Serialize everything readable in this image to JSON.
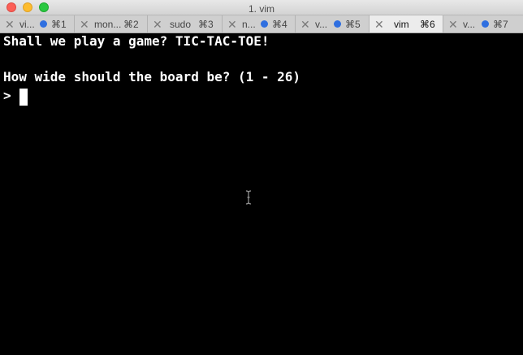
{
  "window": {
    "title": "1. vim"
  },
  "tabs": [
    {
      "label": "vi...",
      "shortcut": "⌘1",
      "has_dot": true,
      "active": false
    },
    {
      "label": "mon...",
      "shortcut": "⌘2",
      "has_dot": false,
      "active": false
    },
    {
      "label": "sudo",
      "shortcut": "⌘3",
      "has_dot": false,
      "active": false
    },
    {
      "label": "n...",
      "shortcut": "⌘4",
      "has_dot": true,
      "active": false
    },
    {
      "label": "v...",
      "shortcut": "⌘5",
      "has_dot": true,
      "active": false
    },
    {
      "label": "vim",
      "shortcut": "⌘6",
      "has_dot": false,
      "active": true
    },
    {
      "label": "v...",
      "shortcut": "⌘7",
      "has_dot": true,
      "active": false
    }
  ],
  "terminal": {
    "line1": "Shall we play a game? TIC-TAC-TOE!",
    "line2": "How wide should the board be? (1 - 26)",
    "prompt": ">"
  },
  "colors": {
    "terminal_bg": "#000000",
    "terminal_fg": "#ffffff",
    "tab_dot": "#2f6fe0",
    "close_light": "#fc5f57",
    "minimize_light": "#fdbc2e",
    "maximize_light": "#29c840"
  }
}
